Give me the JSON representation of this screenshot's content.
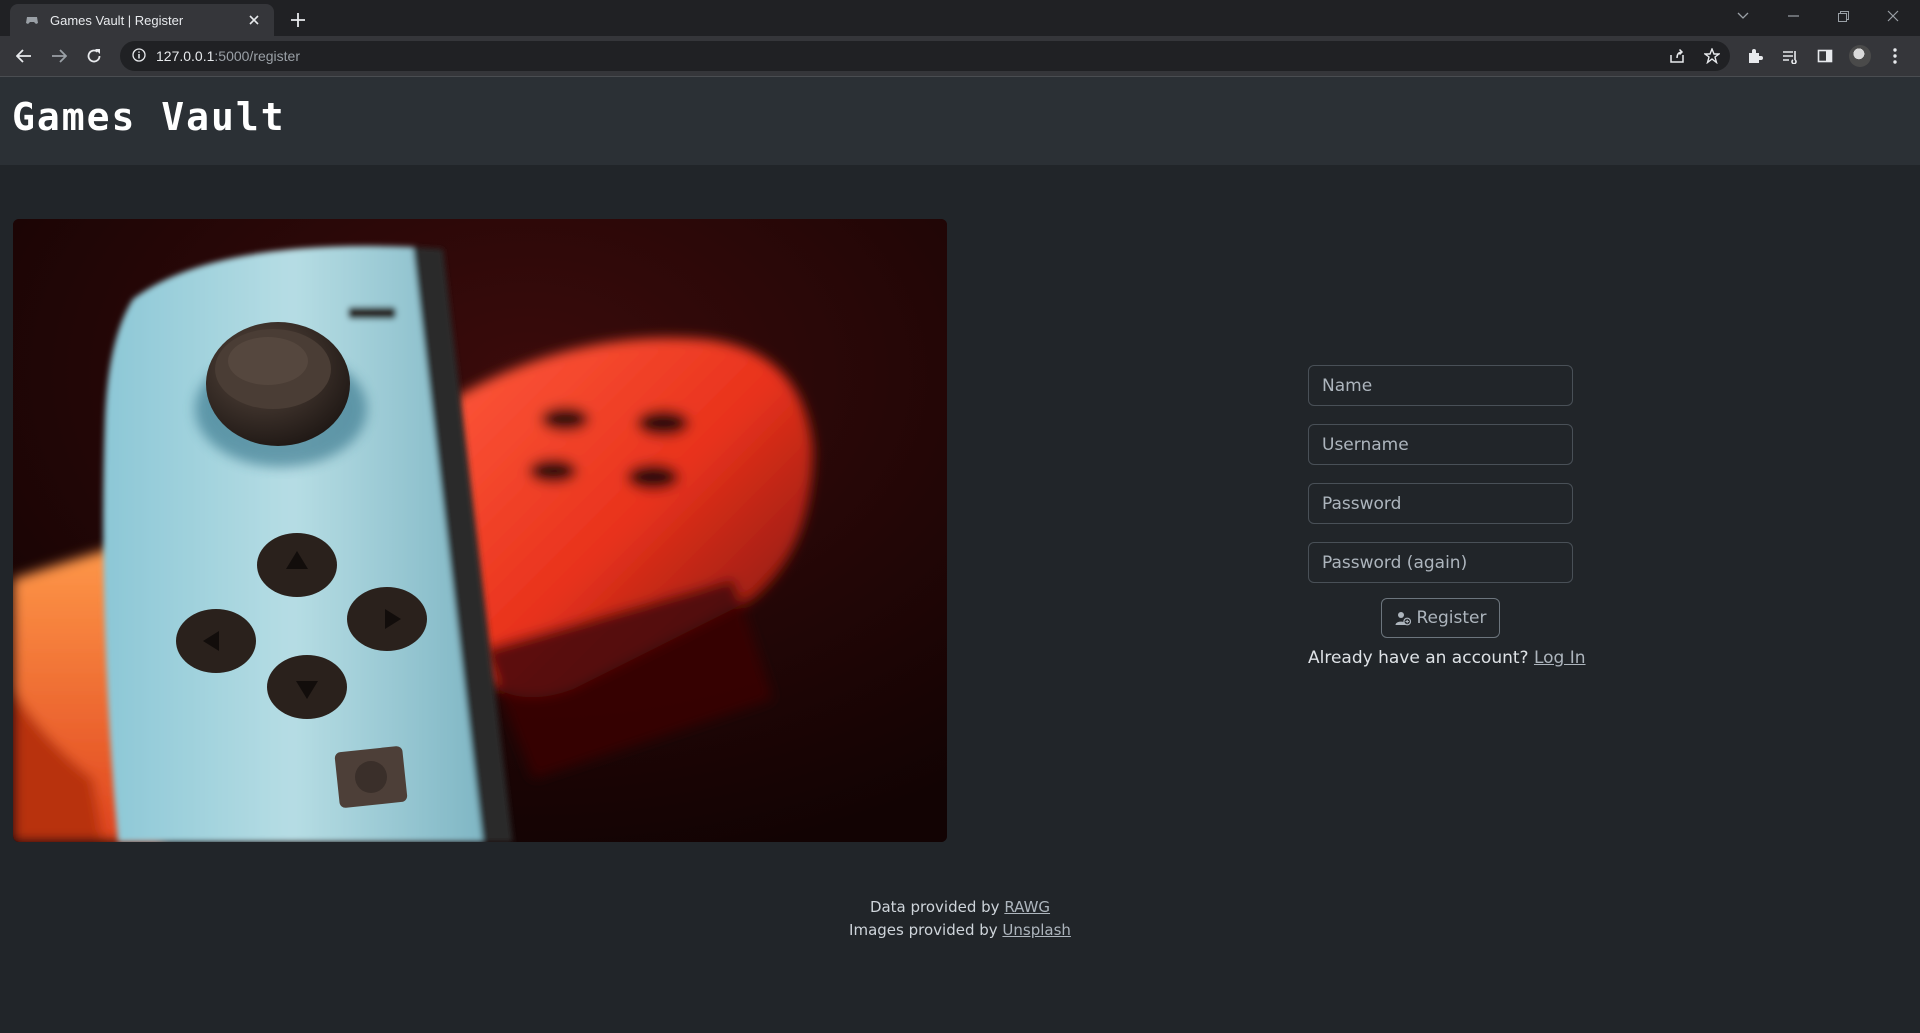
{
  "browser": {
    "tab_title": "Games Vault | Register",
    "url_host": "127.0.0.1",
    "url_path": ":5000/register"
  },
  "header": {
    "brand": "Games Vault"
  },
  "hero": {
    "icon": "game-controller-photo"
  },
  "form": {
    "name_placeholder": "Name",
    "username_placeholder": "Username",
    "password_placeholder": "Password",
    "password_again_placeholder": "Password (again)",
    "register_label": "Register",
    "login_prompt": "Already have an account?",
    "login_link": "Log In"
  },
  "footer": {
    "data_prefix": "Data provided by",
    "data_link": "RAWG",
    "images_prefix": "Images provided by",
    "images_link": "Unsplash"
  },
  "colors": {
    "page_bg": "#212529",
    "header_bg": "#2b3035",
    "input_border": "#495057"
  }
}
